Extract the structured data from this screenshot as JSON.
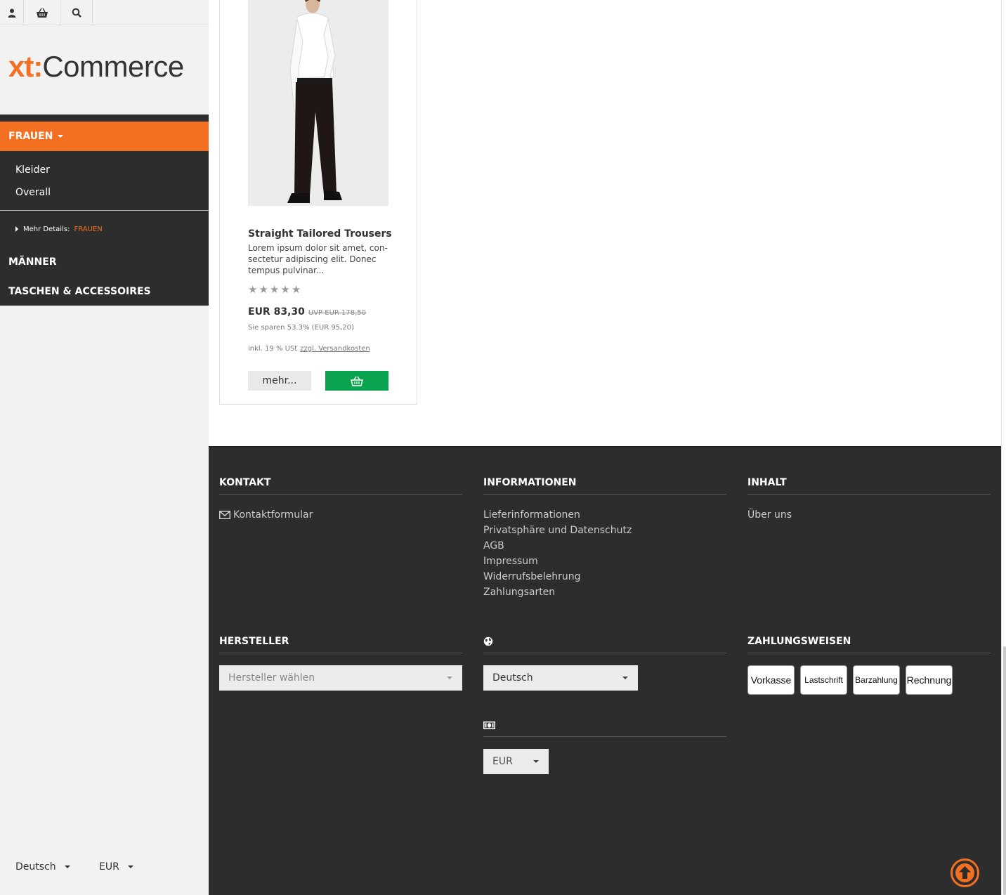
{
  "header": {
    "icons": [
      "user-icon",
      "basket-icon",
      "search-icon"
    ]
  },
  "logo": {
    "xt": "xt:",
    "commerce": "Commerce"
  },
  "nav": {
    "active": "FRAUEN",
    "subitems": [
      "Kleider",
      "Overall"
    ],
    "more_label": "Mehr Details:",
    "more_link": "FRAUEN",
    "items": [
      "MÄNNER",
      "TASCHEN & ACCESSOIRES"
    ]
  },
  "sidebar_bottom": {
    "language": "Deutsch",
    "currency": "EUR"
  },
  "product": {
    "title": "Straight Tailored Trousers",
    "description": "Lorem ipsum dolor sit amet, con-sectetur adipiscing elit. Donec tempus pulvinar...",
    "rating": 0,
    "rating_max": 5,
    "price": "EUR 83,30",
    "old_price": "UVP EUR 178,50",
    "savings": "Sie sparen 53.3% (EUR 95,20)",
    "tax": "inkl. 19 % USt",
    "shipping_link": "zzgl. Versandkosten",
    "more_button": "mehr..."
  },
  "footer": {
    "kontakt": {
      "title": "KONTAKT",
      "links": [
        "Kontaktformular"
      ]
    },
    "informationen": {
      "title": "INFORMATIONEN",
      "links": [
        "Lieferinformationen",
        "Privatsphäre und Datenschutz",
        "AGB",
        "Impressum",
        "Widerrufsbelehrung",
        "Zahlungsarten"
      ]
    },
    "inhalt": {
      "title": "INHALT",
      "links": [
        "Über uns"
      ]
    },
    "hersteller": {
      "title": "HERSTELLER",
      "placeholder": "Hersteller wählen"
    },
    "language": {
      "icon": "globe-icon",
      "value": "Deutsch"
    },
    "currency": {
      "icon": "money-icon",
      "value": "EUR"
    },
    "zahlungsweisen": {
      "title": "ZAHLUNGSWEISEN",
      "methods": [
        "Vorkasse",
        "Lastschrift",
        "Barzahlung",
        "Rechnung"
      ]
    }
  },
  "colors": {
    "accent": "#f36f21",
    "cart_green": "#0aa34f",
    "dark": "#2d2d2d"
  }
}
